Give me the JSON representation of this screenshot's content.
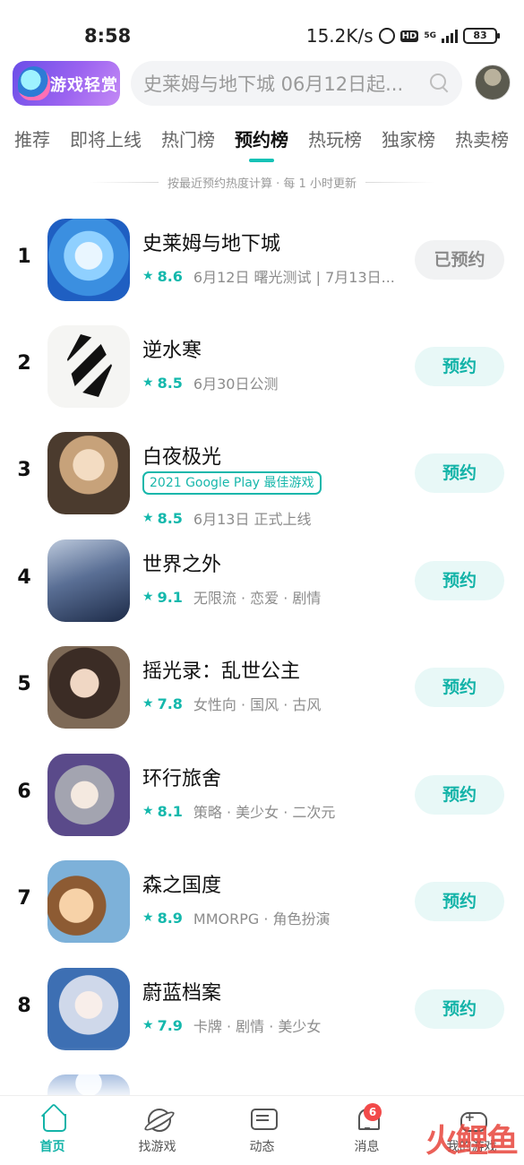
{
  "status_bar": {
    "time": "8:58",
    "net_speed": "15.2K/s",
    "hd": "HD",
    "network": "5G",
    "battery": "83"
  },
  "header": {
    "logo_text": "游戏轻赏",
    "search_placeholder": "史莱姆与地下城 06月12日起..."
  },
  "tabs": [
    {
      "label": "推荐",
      "active": false
    },
    {
      "label": "即将上线",
      "active": false
    },
    {
      "label": "热门榜",
      "active": false
    },
    {
      "label": "预约榜",
      "active": true
    },
    {
      "label": "热玩榜",
      "active": false
    },
    {
      "label": "独家榜",
      "active": false
    },
    {
      "label": "热卖榜",
      "active": false
    }
  ],
  "subtitle": "按最近预约热度计算 · 每 1 小时更新",
  "games": [
    {
      "rank": "1",
      "name": "史莱姆与地下城",
      "score": "8.6",
      "desc": "6月12日  曙光测试 | 7月13日...",
      "button": "已预约",
      "reserved": true
    },
    {
      "rank": "2",
      "name": "逆水寒",
      "score": "8.5",
      "desc": "6月30日公测",
      "button": "预约",
      "reserved": false
    },
    {
      "rank": "3",
      "name": "白夜极光",
      "award": "2021 Google Play 最佳游戏",
      "score": "8.5",
      "desc": "6月13日  正式上线",
      "button": "预约",
      "reserved": false
    },
    {
      "rank": "4",
      "name": "世界之外",
      "score": "9.1",
      "desc": "无限流 · 恋爱 · 剧情",
      "button": "预约",
      "reserved": false
    },
    {
      "rank": "5",
      "name": "摇光录：乱世公主",
      "score": "7.8",
      "desc": "女性向 · 国风 · 古风",
      "button": "预约",
      "reserved": false
    },
    {
      "rank": "6",
      "name": "环行旅舍",
      "score": "8.1",
      "desc": "策略 · 美少女 · 二次元",
      "button": "预约",
      "reserved": false
    },
    {
      "rank": "7",
      "name": "森之国度",
      "score": "8.9",
      "desc": "MMORPG · 角色扮演",
      "button": "预约",
      "reserved": false
    },
    {
      "rank": "8",
      "name": "蔚蓝档案",
      "score": "7.9",
      "desc": "卡牌 · 剧情 · 美少女",
      "button": "预约",
      "reserved": false
    }
  ],
  "bottom_nav": [
    {
      "label": "首页",
      "icon": "home-icon",
      "active": true
    },
    {
      "label": "找游戏",
      "icon": "planet-icon",
      "active": false
    },
    {
      "label": "动态",
      "icon": "chat-icon",
      "active": false
    },
    {
      "label": "消息",
      "icon": "bell-icon",
      "active": false,
      "badge": "6"
    },
    {
      "label": "我的游戏",
      "icon": "gamepad-icon",
      "active": false
    }
  ],
  "watermark": "火鲤鱼",
  "colors": {
    "accent": "#13b3a8",
    "badge": "#f24a4a"
  }
}
